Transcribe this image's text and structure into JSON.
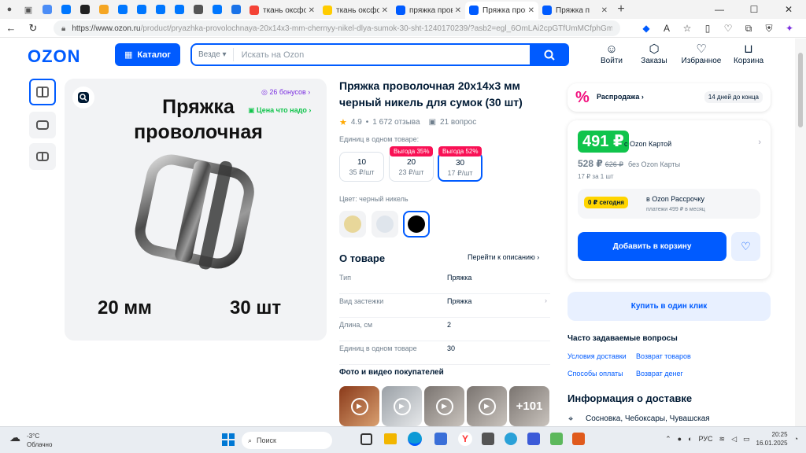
{
  "browser": {
    "tabs": [
      {
        "label": "",
        "color": "#4c8df6"
      },
      {
        "label": "",
        "color": "#0077ff"
      },
      {
        "label": "",
        "color": "#222222"
      },
      {
        "label": "",
        "color": "#f5a623"
      },
      {
        "label": "",
        "color": "#0077ff"
      },
      {
        "label": "",
        "color": "#0077ff"
      },
      {
        "label": "",
        "color": "#0077ff"
      },
      {
        "label": "",
        "color": "#0077ff"
      },
      {
        "label": "",
        "color": "#555555"
      },
      {
        "label": "",
        "color": "#0077ff"
      },
      {
        "label": "",
        "color": "#1a73e8"
      }
    ],
    "named_tabs": [
      {
        "label": "ткань оксфорд",
        "color": "#f44336"
      },
      {
        "label": "ткань оксфорд",
        "color": "#ffcc00"
      },
      {
        "label": "пряжка провол",
        "color": "#005bff"
      },
      {
        "label": "Пряжка пров",
        "color": "#005bff"
      },
      {
        "label": "Пряжка п",
        "color": "#005bff"
      }
    ],
    "url_main": "https://www.ozon.ru",
    "url_rest": "/product/pryazhka-provolochnaya-20x14x3-mm-chernyy-nikel-dlya-sumok-30-sht-1240170239/?asb2=egl_6OmLAi2cpGTfUmMCfphGmy..."
  },
  "header": {
    "logo": "OZON",
    "catalog": "Каталог",
    "search_scope": "Везде",
    "search_placeholder": "Искать на Ozon",
    "icons": [
      {
        "label": "Войти",
        "icon": "user-icon"
      },
      {
        "label": "Заказы",
        "icon": "box-icon"
      },
      {
        "label": "Избранное",
        "icon": "heart-icon"
      },
      {
        "label": "Корзина",
        "icon": "cart-icon"
      }
    ]
  },
  "gallery": {
    "bonus": "26 бонусов",
    "good_price": "Цена что надо",
    "image_title": "Пряжка проволочная",
    "image_size": "20 мм",
    "image_qty": "30 шт"
  },
  "product": {
    "title": "Пряжка проволочная 20х14х3 мм черный никель для сумок (30 шт)",
    "rating": "4.9",
    "reviews": "1 672 отзыва",
    "questions": "21 вопрос",
    "qty_label": "Единиц в одном товаре:",
    "qty_options": [
      {
        "qty": "10",
        "price": "35 ₽/шт",
        "badge": ""
      },
      {
        "qty": "20",
        "price": "23 ₽/шт",
        "badge": "Выгода 35%"
      },
      {
        "qty": "30",
        "price": "17 ₽/шт",
        "badge": "Выгода 52%"
      }
    ],
    "color_label": "Цвет: черный никель",
    "swatches": [
      "#e8d79a",
      "#dfe5ec",
      "#000000"
    ]
  },
  "about": {
    "title": "О товаре",
    "link": "Перейти к описанию",
    "specs": [
      {
        "key": "Тип",
        "value": "Пряжка"
      },
      {
        "key": "Вид застежки",
        "value": "Пряжка"
      },
      {
        "key": "Длина, см",
        "value": "2"
      },
      {
        "key": "Единиц в одном товаре",
        "value": "30"
      }
    ],
    "photos_title": "Фото и видео покупателей",
    "photos_more": "+101"
  },
  "buybox": {
    "sale": "Распродажа",
    "sale_days": "14 дней до конца",
    "price_card": "491 ₽",
    "price_card_label": "с Ozon Картой",
    "price_regular": "528 ₽",
    "price_old": "626 ₽",
    "price_regular_label": "без Ozon Карты",
    "per_unit": "17 ₽ за 1 шт",
    "install_badge": "0 ₽ сегодня",
    "install_title": "в Ozon Рассрочку",
    "install_sub": "платежи 499 ₽ в месяц",
    "add_to_cart": "Добавить в корзину",
    "one_click": "Купить в один клик"
  },
  "faq": {
    "title": "Часто задаваемые вопросы",
    "links": [
      "Условия доставки",
      "Возврат товаров",
      "Способы оплаты",
      "Возврат денег"
    ]
  },
  "delivery": {
    "title": "Информация о доставке",
    "city": "Сосновка, Чебоксары, Чувашская"
  },
  "taskbar": {
    "temp": "-3°C",
    "weather": "Облачно",
    "search": "Поиск",
    "lang": "РУС",
    "time": "20:25",
    "date": "16.01.2025"
  },
  "colors": {
    "accent": "#005bff",
    "green": "#10c44c",
    "sale_pink": "#f91155"
  }
}
